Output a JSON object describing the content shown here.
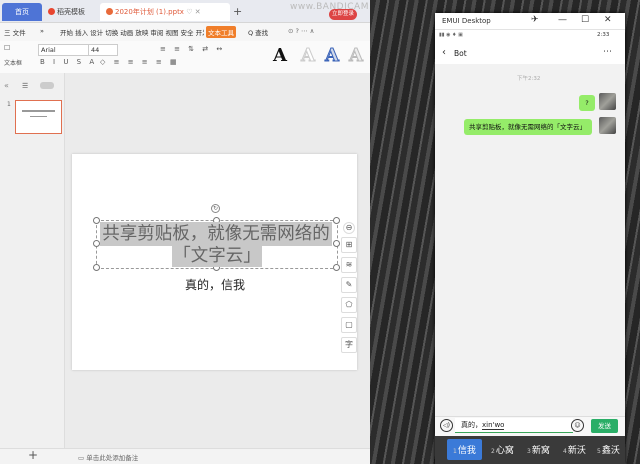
{
  "wps": {
    "tabs": {
      "home": "首页",
      "template": "稻壳模板",
      "file": "2020年计划 (1).pptx"
    },
    "add_tab": "+",
    "watermark": "www.BANDICAM.com",
    "rec_badge": "立即登录",
    "menu": {
      "file": "三 文件",
      "more": "»",
      "items": "开始 插入 设计 切换 动画 放映 审阅 视图 安全 开发工具 特色应用 绘图工具",
      "tool_tab": "文本工具",
      "search": "Q 查找"
    },
    "ribbon": {
      "textbox": "文本框",
      "font_name": "Arial",
      "font_size": "44",
      "format_row": "B I U S A",
      "style_letter": "A"
    },
    "slide_num": "1",
    "slide": {
      "title_line1": "共享剪贴板，就像无需网络的",
      "title_line2": "「文字云」",
      "subtitle": "真的，信我"
    },
    "side_tools": [
      "⊖",
      "⊞",
      "≋",
      "✎",
      "⬠",
      "▢",
      "字"
    ],
    "notes_hint": "单击此处添加备注",
    "add_slide": "+"
  },
  "emui": {
    "window_title": "EMUI Desktop",
    "status_time": "2:33",
    "chat_name": "Bot",
    "chat_time": "下午2:32",
    "messages": [
      {
        "text": "?"
      },
      {
        "text": "共享剪贴板，就像无需网络的「文字云」"
      }
    ],
    "input_prefix": "真的，",
    "input_composing": "xin'wo",
    "send_label": "发送",
    "candidates": [
      {
        "n": "1",
        "text": "信我"
      },
      {
        "n": "2",
        "text": "心窝"
      },
      {
        "n": "3",
        "text": "新窝"
      },
      {
        "n": "4",
        "text": "新沃"
      },
      {
        "n": "5",
        "text": "鑫沃"
      }
    ]
  }
}
